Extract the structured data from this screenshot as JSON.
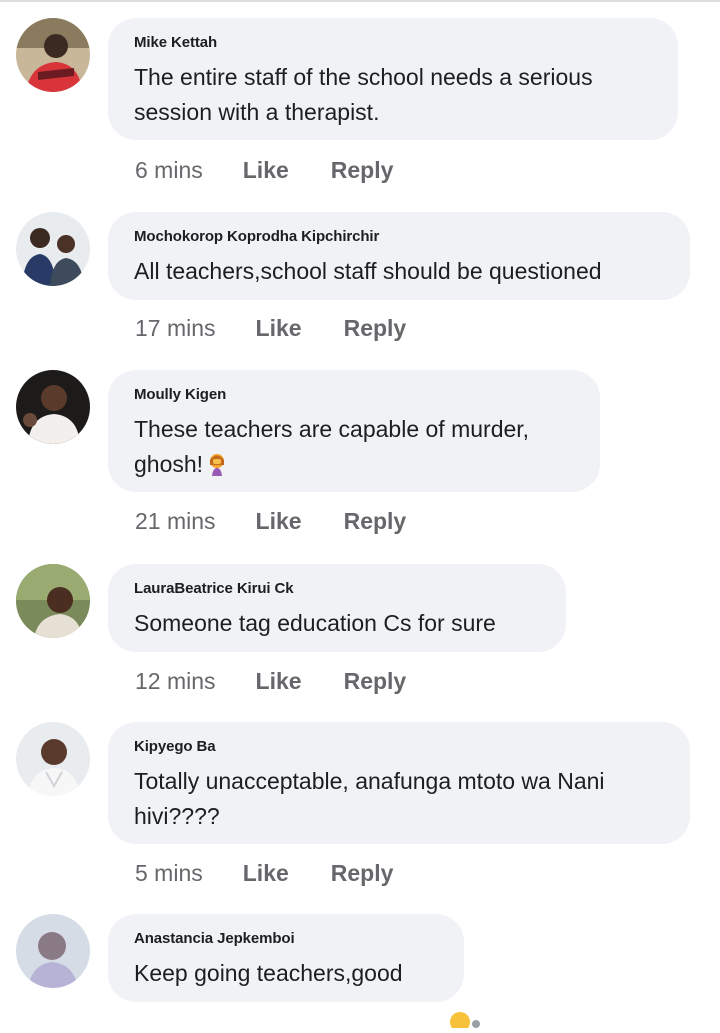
{
  "comments": [
    {
      "author": "Mike Kettah",
      "text": "The entire staff of the school needs a serious session with a therapist.",
      "time": "6 mins",
      "like": "Like",
      "reply": "Reply",
      "avatar_icon": "person-photo-icon"
    },
    {
      "author": "Mochokorop Koprodha Kipchirchir",
      "text": "All teachers,school staff should be questioned",
      "time": "17 mins",
      "like": "Like",
      "reply": "Reply",
      "avatar_icon": "two-people-photo-icon"
    },
    {
      "author": "Moully Kigen",
      "text": "These teachers are capable of murder, ghosh!",
      "time": "21 mins",
      "like": "Like",
      "reply": "Reply",
      "avatar_icon": "person-photo-icon",
      "emoji_icon": "woman-facepalming-emoji"
    },
    {
      "author": "LauraBeatrice Kirui Ck",
      "text": "Someone tag education Cs for sure",
      "time": "12 mins",
      "like": "Like",
      "reply": "Reply",
      "avatar_icon": "person-outdoor-photo-icon"
    },
    {
      "author": "Kipyego Ba",
      "text": "Totally unacceptable, anafunga mtoto wa Nani hivi????",
      "time": "5 mins",
      "like": "Like",
      "reply": "Reply",
      "avatar_icon": "person-photo-icon"
    },
    {
      "author": "Anastancia Jepkemboi",
      "text": "Keep going teachers,good",
      "avatar_icon": "person-blurred-photo-icon"
    }
  ],
  "colors": {
    "bubble": "#f0f2f5",
    "meta_text": "#65676b",
    "body_text": "#1c1e21"
  }
}
